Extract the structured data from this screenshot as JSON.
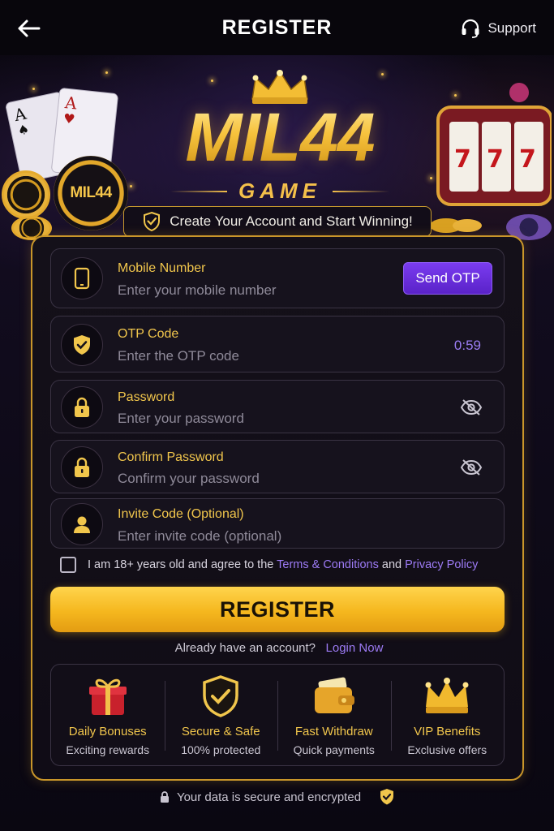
{
  "header": {
    "title": "REGISTER",
    "support_label": "Support"
  },
  "hero": {
    "logo_title": "MIL44",
    "logo_subtitle": "GAME",
    "chip_logo": "MIL44",
    "tagline": "Create Your Account and Start Winning!"
  },
  "form": {
    "mobile": {
      "label": "Mobile Number",
      "placeholder": "Enter your mobile number",
      "send_otp_label": "Send OTP",
      "icon": "phone-icon"
    },
    "otp": {
      "label": "OTP Code",
      "placeholder": "Enter the OTP code",
      "timer": "0:59",
      "icon": "shield-check-icon"
    },
    "password": {
      "label": "Password",
      "placeholder": "Enter your password",
      "icon": "lock-icon"
    },
    "confirm_password": {
      "label": "Confirm Password",
      "placeholder": "Confirm your password",
      "icon": "lock-icon"
    },
    "invite": {
      "label": "Invite Code (Optional)",
      "placeholder": "Enter invite code (optional)",
      "icon": "user-icon"
    },
    "agree": {
      "text": "I am 18+ years old and agree to the",
      "terms": "Terms & Conditions",
      "and": "and",
      "privacy": "Privacy Policy",
      "checked": false
    },
    "register_label": "REGISTER",
    "login_prompt": "Already have an account?",
    "login_link": "Login Now"
  },
  "benefits": [
    {
      "title": "Daily Bonuses",
      "subtitle": "Exciting rewards",
      "icon": "gift-icon"
    },
    {
      "title": "Secure & Safe",
      "subtitle": "100% protected",
      "icon": "shield-icon"
    },
    {
      "title": "Fast Withdraw",
      "subtitle": "Quick payments",
      "icon": "wallet-icon"
    },
    {
      "title": "VIP Benefits",
      "subtitle": "Exclusive offers",
      "icon": "crown-icon"
    }
  ],
  "footer": {
    "secure_text": "Your data is secure and encrypted"
  },
  "colors": {
    "accent_gold": "#f1c64c",
    "accent_purple": "#7a3cf0",
    "link_purple": "#9d7bf5",
    "background": "#0b0812"
  }
}
